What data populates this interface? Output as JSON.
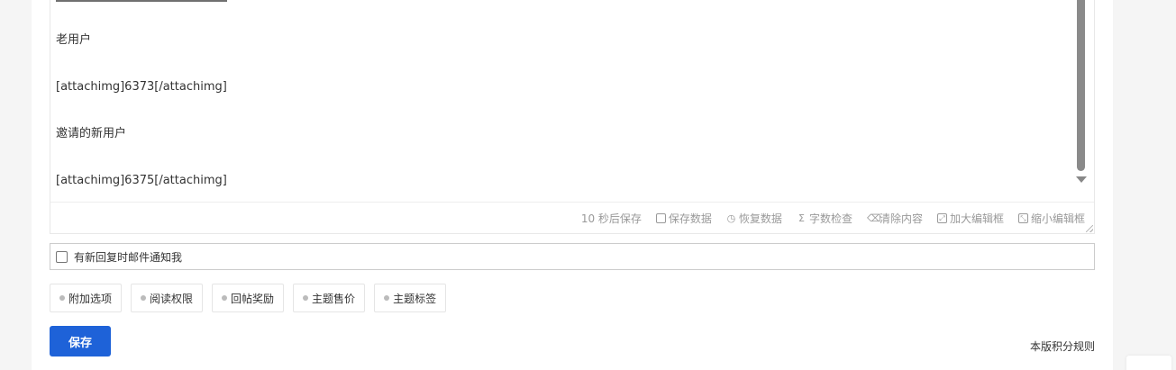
{
  "editor": {
    "lines": [
      "老用户",
      "[attachimg]6373[/attachimg]",
      "邀请的新用户",
      "[attachimg]6375[/attachimg]"
    ],
    "footer": {
      "autosave": "10 秒后保存",
      "save_data": "保存数据",
      "restore_data": "恢复数据",
      "word_check": "字数检查",
      "clear_content": "清除内容",
      "enlarge_editor": "加大编辑框",
      "shrink_editor": "缩小编辑框"
    }
  },
  "notify": {
    "label": "有新回复时邮件通知我",
    "checked": false
  },
  "options": [
    "附加选项",
    "阅读权限",
    "回帖奖励",
    "主题售价",
    "主题标签"
  ],
  "save_button": "保存",
  "rules_link": "本版积分规则",
  "colors": {
    "primary": "#1e62d8",
    "muted": "#999999"
  }
}
